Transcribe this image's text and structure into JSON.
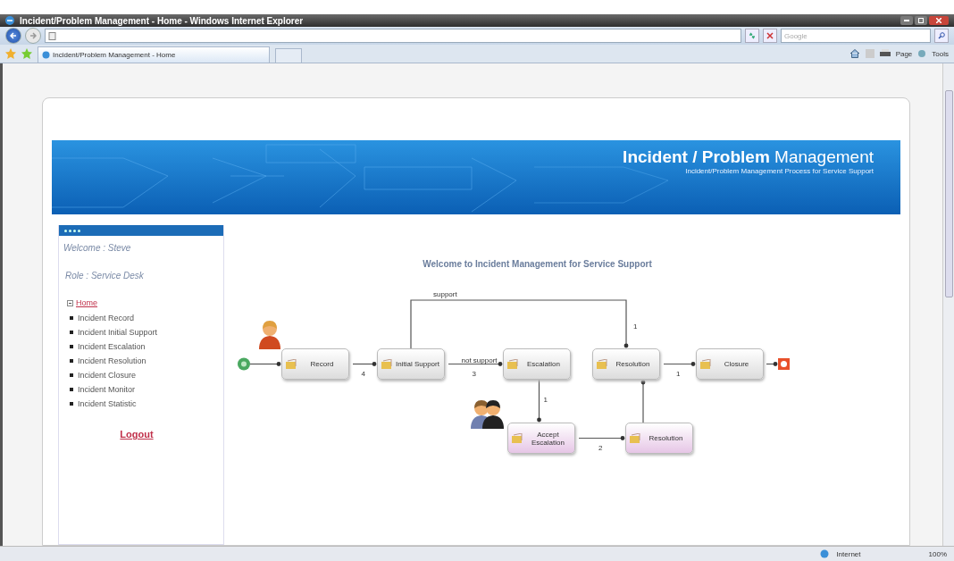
{
  "window": {
    "title": "Incident/Problem Management - Home - Windows Internet Explorer"
  },
  "address_bar": {
    "search_placeholder": "Google"
  },
  "tabs": [
    {
      "label": "Incident/Problem Management - Home",
      "selected": true
    }
  ],
  "toolbar": {
    "page": "Page",
    "tools": "Tools"
  },
  "banner": {
    "title": "**Incident / Problem** Management",
    "subtitle": "Incident/Problem Management Process for Service Support"
  },
  "sidebar": {
    "welcome": "Welcome : Steve",
    "role": "Role : Service Desk",
    "home": "Home",
    "items": [
      "Incident Record",
      "Incident Initial Support",
      "Incident Escalation",
      "Incident Resolution",
      "Incident Closure",
      "Incident Monitor",
      "Incident Statistic"
    ],
    "logout": "Logout"
  },
  "main": {
    "title": "Welcome to Incident Management for Service Support",
    "nodes": [
      {
        "label": "Record",
        "color": "#dcdcdc"
      },
      {
        "label": "Initial Support",
        "color": "#dcdcdc"
      },
      {
        "label": "Escalation",
        "color": "#dcdcdc"
      },
      {
        "label": "Resolution",
        "color": "#dcdcdc"
      },
      {
        "label": "Closure",
        "color": "#dcdcdc"
      },
      {
        "label": "Accept Escalation",
        "color": "#e6c6e6"
      },
      {
        "label": "Resolution",
        "color": "#e6c6e6"
      }
    ],
    "edges": [
      {
        "count": "4"
      },
      {
        "label": "not support",
        "count": "3"
      },
      {
        "label": "support",
        "count": "1"
      },
      {
        "count": "1"
      },
      {
        "count": "1"
      },
      {
        "count": "2"
      }
    ]
  },
  "status_bar": {
    "zone": "Internet",
    "zoom": "100%"
  }
}
